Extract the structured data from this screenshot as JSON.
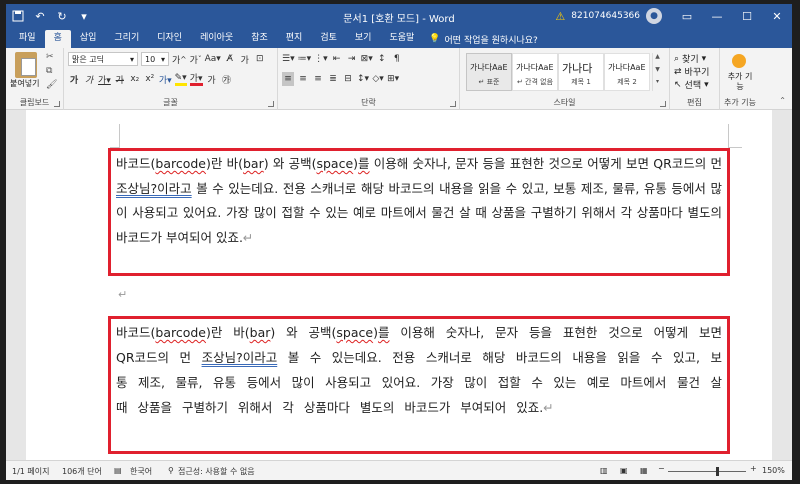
{
  "titlebar": {
    "title": "문서1 [호환 모드] - Word",
    "account": "821074645366",
    "icons": [
      "save-icon",
      "undo-icon",
      "redo-icon",
      "customize-qat-icon"
    ]
  },
  "tabs": [
    "파일",
    "홈",
    "삽입",
    "그리기",
    "디자인",
    "레이아웃",
    "참조",
    "편지",
    "검토",
    "보기",
    "도움말"
  ],
  "active_tab": "홈",
  "tell_me": "어떤 작업을 원하시나요?",
  "ribbon": {
    "clipboard": {
      "paste": "붙여넣기",
      "group": "클립보드"
    },
    "font": {
      "name": "맑은 고딕",
      "size": "10",
      "group": "글꼴"
    },
    "paragraph": {
      "group": "단락"
    },
    "styles": {
      "group": "스타일",
      "items": [
        {
          "sample": "가나다AaE",
          "name": "↵ 표준"
        },
        {
          "sample": "가나다AaE",
          "name": "↵ 간격 없음"
        },
        {
          "sample": "가나다",
          "name": "제목 1"
        },
        {
          "sample": "가나다AaE",
          "name": "제목 2"
        }
      ]
    },
    "editing": {
      "find": "찾기",
      "replace": "바꾸기",
      "select": "선택",
      "group": "편집"
    },
    "addins": {
      "label": "추가 기능",
      "group": "추가 기능"
    }
  },
  "document": {
    "para1": {
      "a": "바코드(",
      "b": "barcode",
      "c": ")란 바(",
      "d": "bar",
      "e": ") 와 공백(",
      "f": "space",
      "g": ")",
      "h": "를",
      "i": " 이용해 숫자나, 문자 등을 표현한 것으로 어떻게 보면 QR코드의 먼 ",
      "j": "조상님?이라고",
      "k": " 볼 수 있는데요. 전용 스캐너로 해당 바코드의 내용을 읽을 수 있고, 보통 제조, 물류, 유통 등에서 많이 사용되고 있어요. 가장 많이 접할 수 있는 예로 마트에서 물건 살 때 상품을 구별하기 위해서 각 상품마다 별도의 바코드가 부여되어 있죠.",
      "mark": "↵"
    },
    "empty_mark": "↵",
    "para2": {
      "a": "바코드(",
      "b": "barcode",
      "c": ")란 바(",
      "d": "bar",
      "e": ") 와 공백(",
      "f": "space",
      "g": ")",
      "h": "를",
      "i": " 이용해 숫자나, 문자 등을 표현한 것으로 어떻게 보면 QR코드의 먼 ",
      "j": "조상님?이라고",
      "k": " 볼 수 있는데요. 전용 스캐너로 해당 바코드의 내용을 읽을 수 있고, 보통 제조, 물류, 유통 등에서 많이 사용되고 있어요. 가장 많이 접할 수 있는 예로 마트에서 물건 살 때 상품을 구별하기 위해서 각 상품마다 별도의 바코드가 부여되어 있죠.",
      "mark": "↵"
    }
  },
  "statusbar": {
    "page": "1/1 페이지",
    "words": "106개 단어",
    "lang": "한국어",
    "accessibility": "접근성: 사용할 수 없음",
    "zoom": "150%"
  },
  "colors": {
    "accent": "#2b579a",
    "highlight_box": "#e0202e"
  }
}
